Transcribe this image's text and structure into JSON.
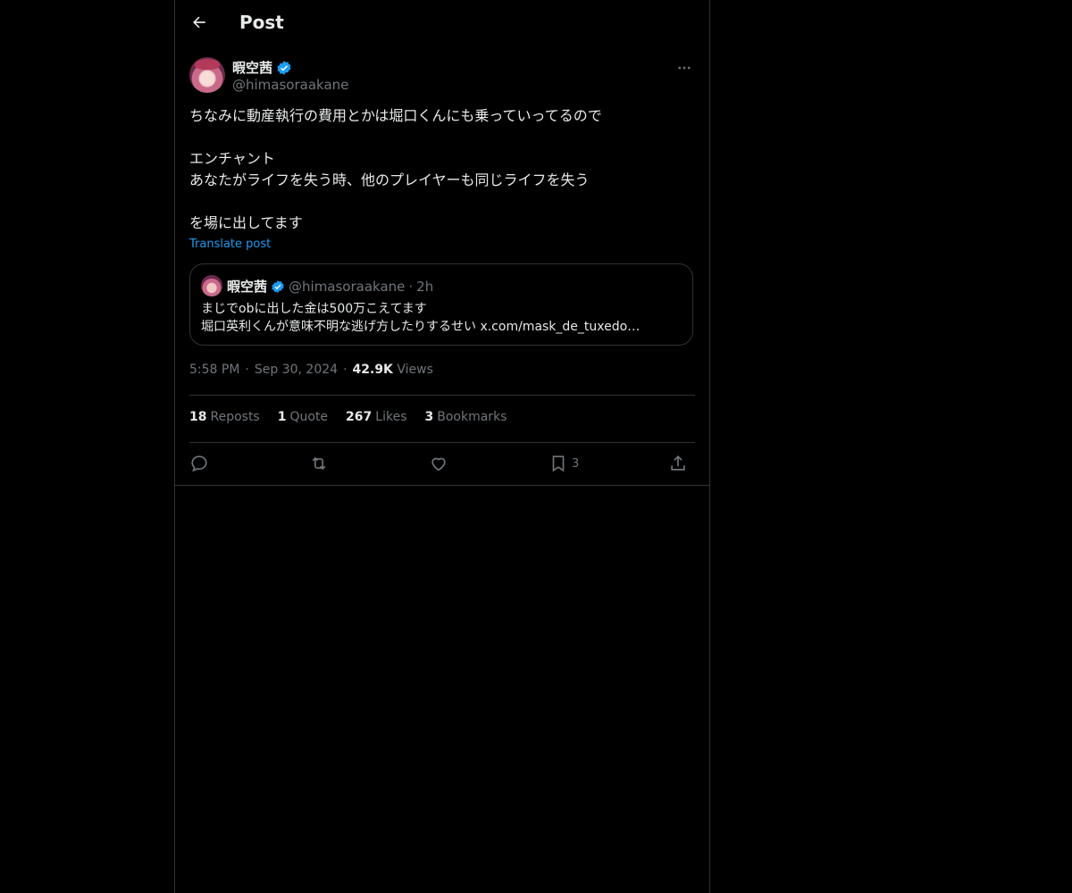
{
  "header": {
    "title": "Post"
  },
  "post": {
    "display_name": "暇空茜",
    "handle": "@himasoraakane",
    "verified": true,
    "text_lines": [
      "ちなみに動産執行の費用とかは堀口くんにも乗っていってるので",
      "",
      "エンチャント",
      "あなたがライフを失う時、他のプレイヤーも同じライフを失う",
      "",
      "を場に出してます"
    ],
    "translate_label": "Translate post",
    "time": "5:58 PM",
    "date": "Sep 30, 2024",
    "views_count": "42.9K",
    "views_label": "Views"
  },
  "quote": {
    "display_name": "暇空茜",
    "handle": "@himasoraakane",
    "separator": "·",
    "age": "2h",
    "line1": "まじでobに出した金は500万こえてます",
    "line2": "堀口英利くんが意味不明な逃げ方したりするせい x.com/mask_de_tuxedo…"
  },
  "stats": {
    "reposts_count": "18",
    "reposts_label": "Reposts",
    "quotes_count": "1",
    "quotes_label": "Quote",
    "likes_count": "267",
    "likes_label": "Likes",
    "bookmarks_count": "3",
    "bookmarks_label": "Bookmarks"
  },
  "actions": {
    "bookmark_count": "3"
  },
  "colors": {
    "accent": "#1d9bf0",
    "muted": "#71767b",
    "text": "#e7e9ea",
    "border": "#2f3336",
    "background": "#000000"
  }
}
